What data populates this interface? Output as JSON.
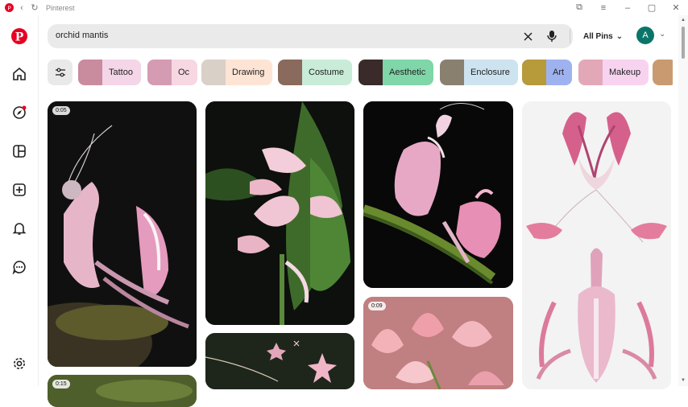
{
  "window": {
    "title": "Pinterest"
  },
  "search": {
    "query": "orchid mantis",
    "filter_label": "All Pins"
  },
  "account": {
    "initial": "A"
  },
  "chips": [
    {
      "label": "Tattoo",
      "bg": "#f5d5e8",
      "thumb": "#c98b9e"
    },
    {
      "label": "Oc",
      "bg": "#f6d7e2",
      "thumb": "#d59bb2"
    },
    {
      "label": "Drawing",
      "bg": "#fde4d4",
      "thumb": "#d9d0c8"
    },
    {
      "label": "Costume",
      "bg": "#c9ecd9",
      "thumb": "#8a6a5c"
    },
    {
      "label": "Aesthetic",
      "bg": "#7fd6a8",
      "thumb": "#3a2a2a"
    },
    {
      "label": "Enclosure",
      "bg": "#cde3f0",
      "thumb": "#8a8070"
    },
    {
      "label": "Art",
      "bg": "#9fb2f0",
      "thumb": "#b79a3a"
    },
    {
      "label": "Makeup",
      "bg": "#f7d3ef",
      "thumb": "#e3a8b8"
    }
  ],
  "pins": [
    {
      "duration": "0:05"
    },
    {
      "duration": "0:09"
    },
    {
      "duration": "0:15"
    }
  ],
  "colors": {
    "brand": "#e60023",
    "accent": "#0c7569"
  }
}
